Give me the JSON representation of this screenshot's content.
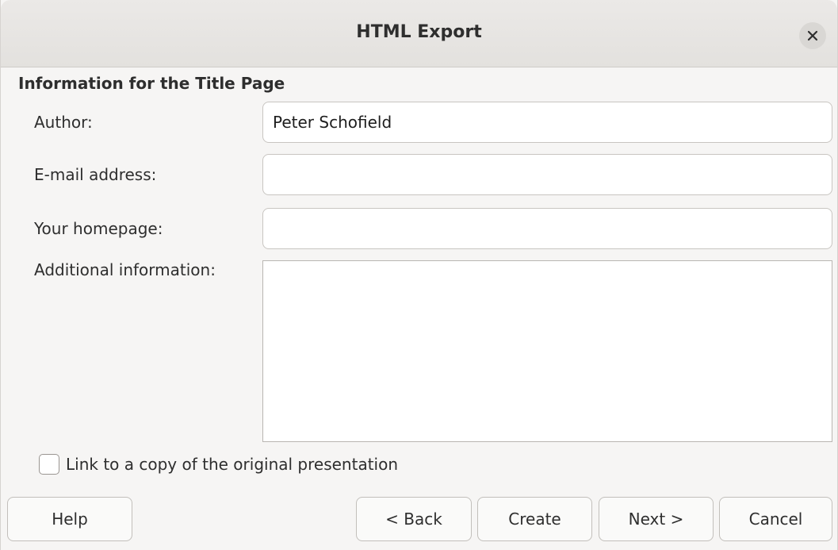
{
  "dialog": {
    "title": "HTML Export",
    "close_icon": "close-icon"
  },
  "section": {
    "heading": "Information for the Title Page"
  },
  "fields": {
    "author_label": "Author:",
    "author_value": "Peter Schofield",
    "email_label": "E-mail address:",
    "email_value": "",
    "homepage_label": "Your homepage:",
    "homepage_value": "",
    "additional_label": "Additional information:",
    "additional_value": ""
  },
  "options": {
    "link_original_label": "Link to a copy of the original presentation",
    "link_original_checked": false
  },
  "buttons": {
    "help": "Help",
    "back": "< Back",
    "create": "Create",
    "next": "Next >",
    "cancel": "Cancel"
  }
}
